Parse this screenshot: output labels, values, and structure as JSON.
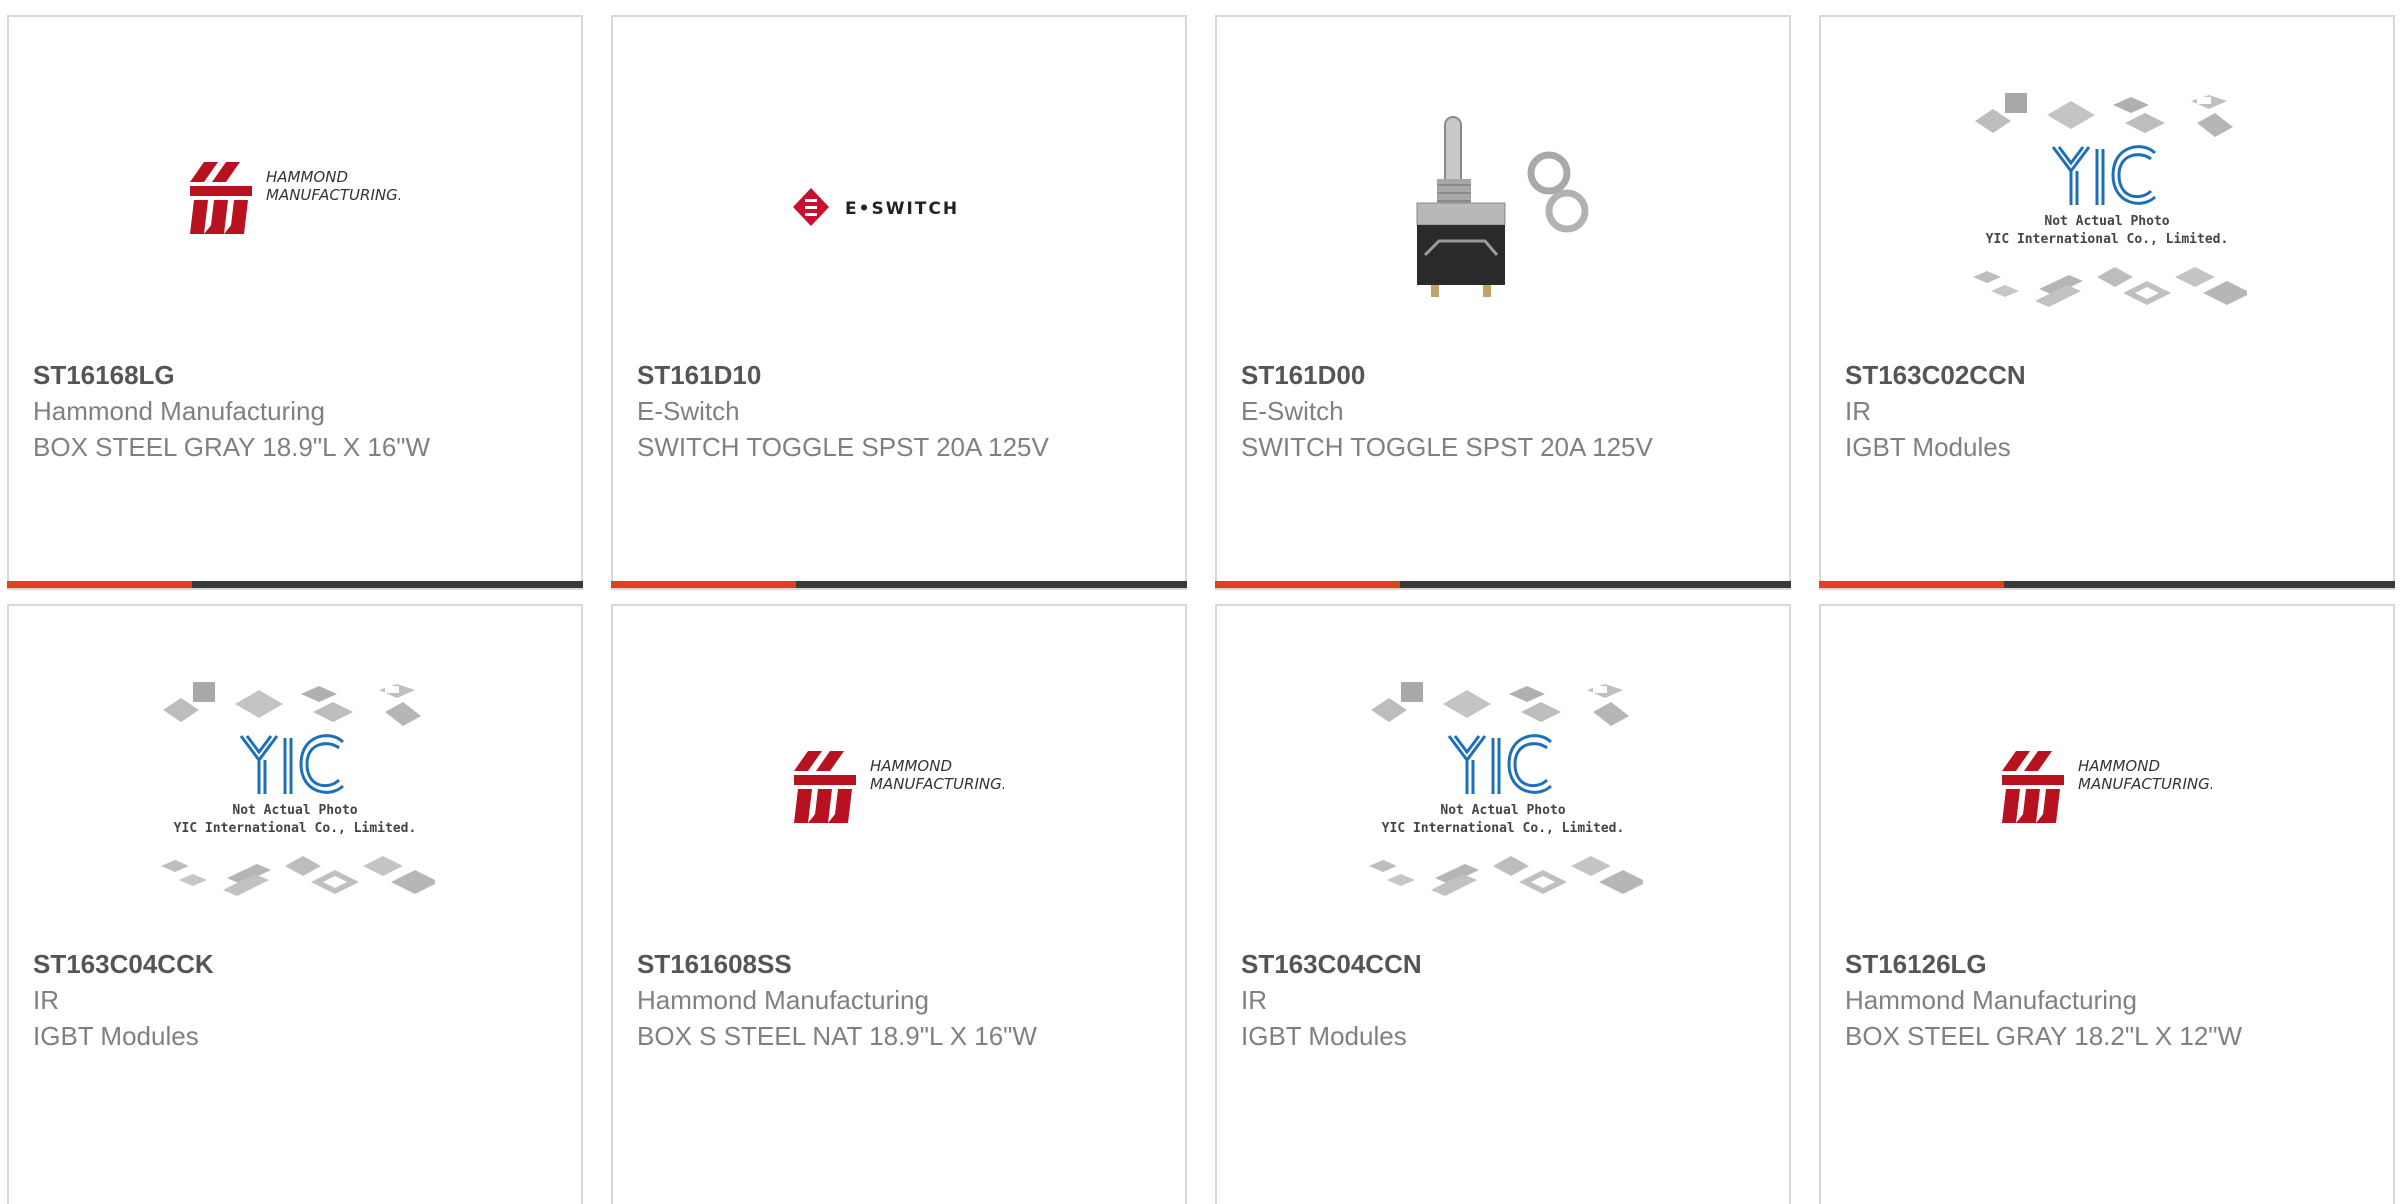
{
  "theme": {
    "accent_color": "#e0401a",
    "bar_color": "#3a3a3a",
    "part_number_color": "#555555",
    "meta_text_color": "#808080"
  },
  "logos": {
    "hammond_line1": "HAMMOND",
    "hammond_line2": "MANUFACTURING.",
    "eswitch_text": "E•SWITCH",
    "yic_brand": "YIC",
    "yic_line1": "Not Actual Photo",
    "yic_line2": "YIC International Co., Limited."
  },
  "products": [
    {
      "part_number": "ST16168LG",
      "manufacturer": "Hammond Manufacturing",
      "description": "BOX STEEL GRAY 18.9\"L X 16\"W",
      "image": "hammond-logo"
    },
    {
      "part_number": "ST161D10",
      "manufacturer": "E-Switch",
      "description": "SWITCH TOGGLE SPST 20A 125V",
      "image": "eswitch-logo"
    },
    {
      "part_number": "ST161D00",
      "manufacturer": "E-Switch",
      "description": "SWITCH TOGGLE SPST 20A 125V",
      "image": "toggle-switch-photo"
    },
    {
      "part_number": "ST163C02CCN",
      "manufacturer": "IR",
      "description": "IGBT Modules",
      "image": "yic-placeholder"
    },
    {
      "part_number": "ST163C04CCK",
      "manufacturer": "IR",
      "description": "IGBT Modules",
      "image": "yic-placeholder"
    },
    {
      "part_number": "ST161608SS",
      "manufacturer": "Hammond Manufacturing",
      "description": "BOX S STEEL NAT 18.9\"L X 16\"W",
      "image": "hammond-logo"
    },
    {
      "part_number": "ST163C04CCN",
      "manufacturer": "IR",
      "description": "IGBT Modules",
      "image": "yic-placeholder"
    },
    {
      "part_number": "ST16126LG",
      "manufacturer": "Hammond Manufacturing",
      "description": "BOX STEEL GRAY 18.2\"L X 12\"W",
      "image": "hammond-logo"
    }
  ]
}
